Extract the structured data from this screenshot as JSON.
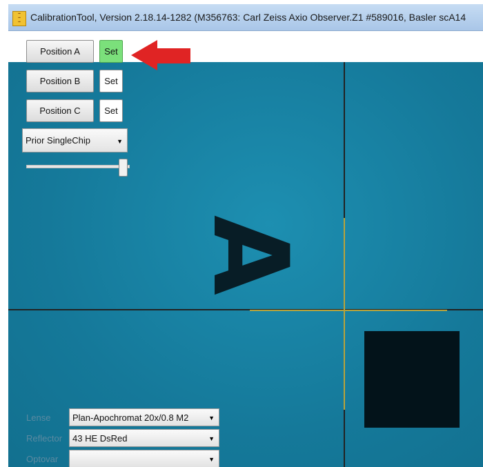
{
  "window": {
    "title": "CalibrationTool, Version 2.18.14-1282 (M356763: Carl Zeiss Axio Observer.Z1 #589016, Basler scA14",
    "icon": "scan-r-app-icon"
  },
  "positions": [
    {
      "label": "Position A",
      "set_label": "Set",
      "set_active": true
    },
    {
      "label": "Position B",
      "set_label": "Set",
      "set_active": false
    },
    {
      "label": "Position C",
      "set_label": "Set",
      "set_active": false
    }
  ],
  "stage": {
    "selected": "Prior SingleChip"
  },
  "slider": {
    "value_fraction": 1.0
  },
  "optics": {
    "lense": {
      "label": "Lense",
      "value": "Plan-Apochromat 20x/0.8 M2"
    },
    "reflector": {
      "label": "Reflector",
      "value": "43 HE DsRed"
    },
    "optovar": {
      "label": "Optovar",
      "value": ""
    }
  },
  "specimen_glyph": "A",
  "colors": {
    "field": "#1686a8",
    "set_active": "#7be07b",
    "arrow": "#e02424",
    "crosshair": "#b9a33a"
  }
}
